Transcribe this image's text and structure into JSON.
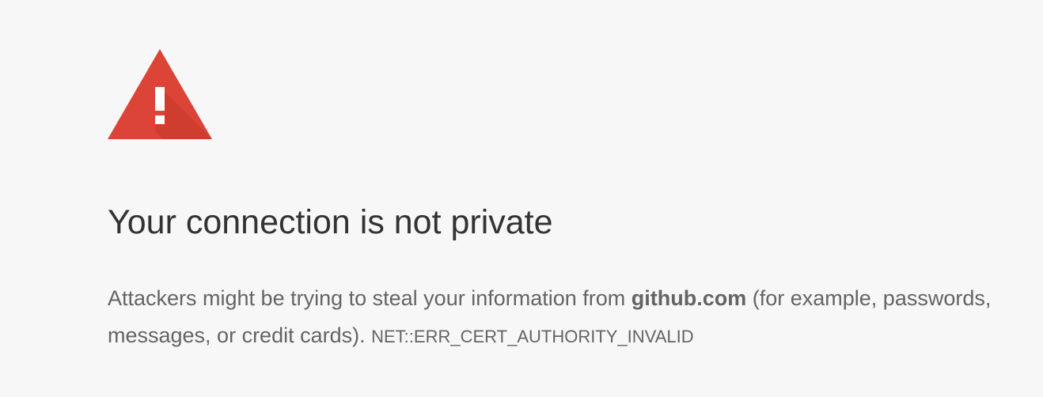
{
  "icon": {
    "name": "warning-triangle-icon",
    "color": "#db4437",
    "shadow_color": "#c53929"
  },
  "title": "Your connection is not private",
  "message": {
    "text_before_domain": "Attackers might be trying to steal your information from ",
    "domain": "github.com",
    "text_after_domain": " (for example, passwords, messages, or credit cards). ",
    "error_code": "NET::ERR_CERT_AUTHORITY_INVALID"
  },
  "colors": {
    "background": "#f7f7f7",
    "title": "#333333",
    "body_text": "#646464"
  }
}
